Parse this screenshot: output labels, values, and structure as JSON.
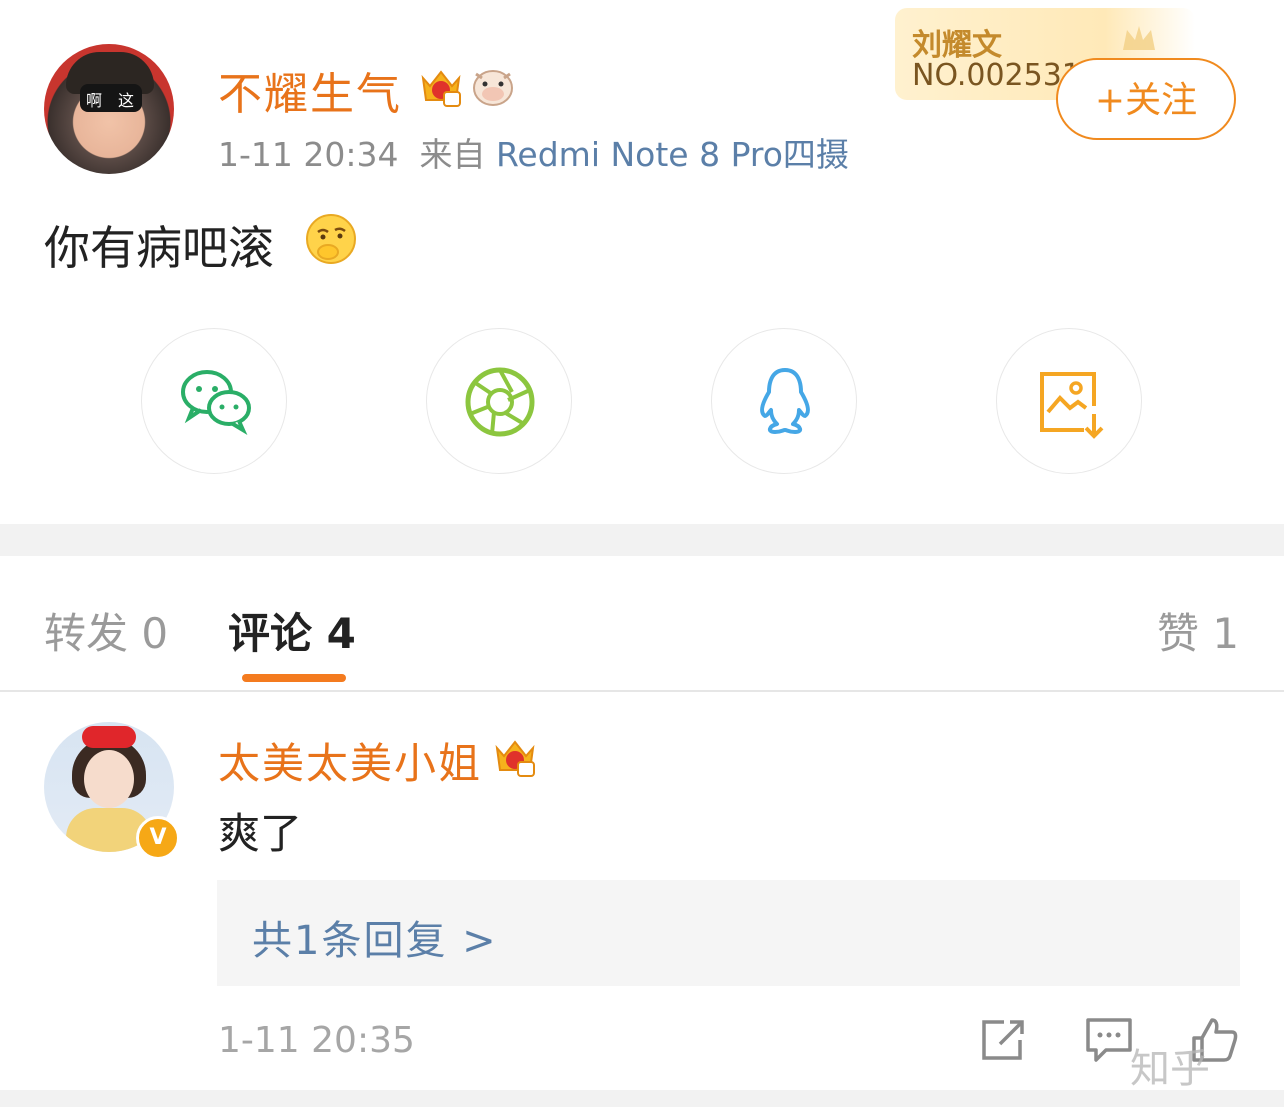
{
  "post": {
    "author": "不耀生气",
    "time": "1-11 20:34",
    "source_prefix": "来自",
    "source": "Redmi Note 8 Pro四摄",
    "text": "你有病吧滚",
    "follow_label": "+关注",
    "fan_card": {
      "name": "刘耀文",
      "number": "NO.002531"
    },
    "avatar_text_left": "啊",
    "avatar_text_right": "这"
  },
  "share": [
    {
      "name": "wechat",
      "color": "#2aae67"
    },
    {
      "name": "moments",
      "color": "#8cc63f"
    },
    {
      "name": "qq",
      "color": "#45a7e6"
    },
    {
      "name": "save-image",
      "color": "#f5a623"
    }
  ],
  "tabs": {
    "repost_label": "转发",
    "repost_count": "0",
    "comment_label": "评论",
    "comment_count": "4",
    "like_label": "赞",
    "like_count": "1"
  },
  "comment": {
    "author": "太美太美小姐",
    "text": "爽了",
    "reply_link": "共1条回复 >",
    "time": "1-11 20:35",
    "verified_mark": "V"
  },
  "watermark": "知乎"
}
